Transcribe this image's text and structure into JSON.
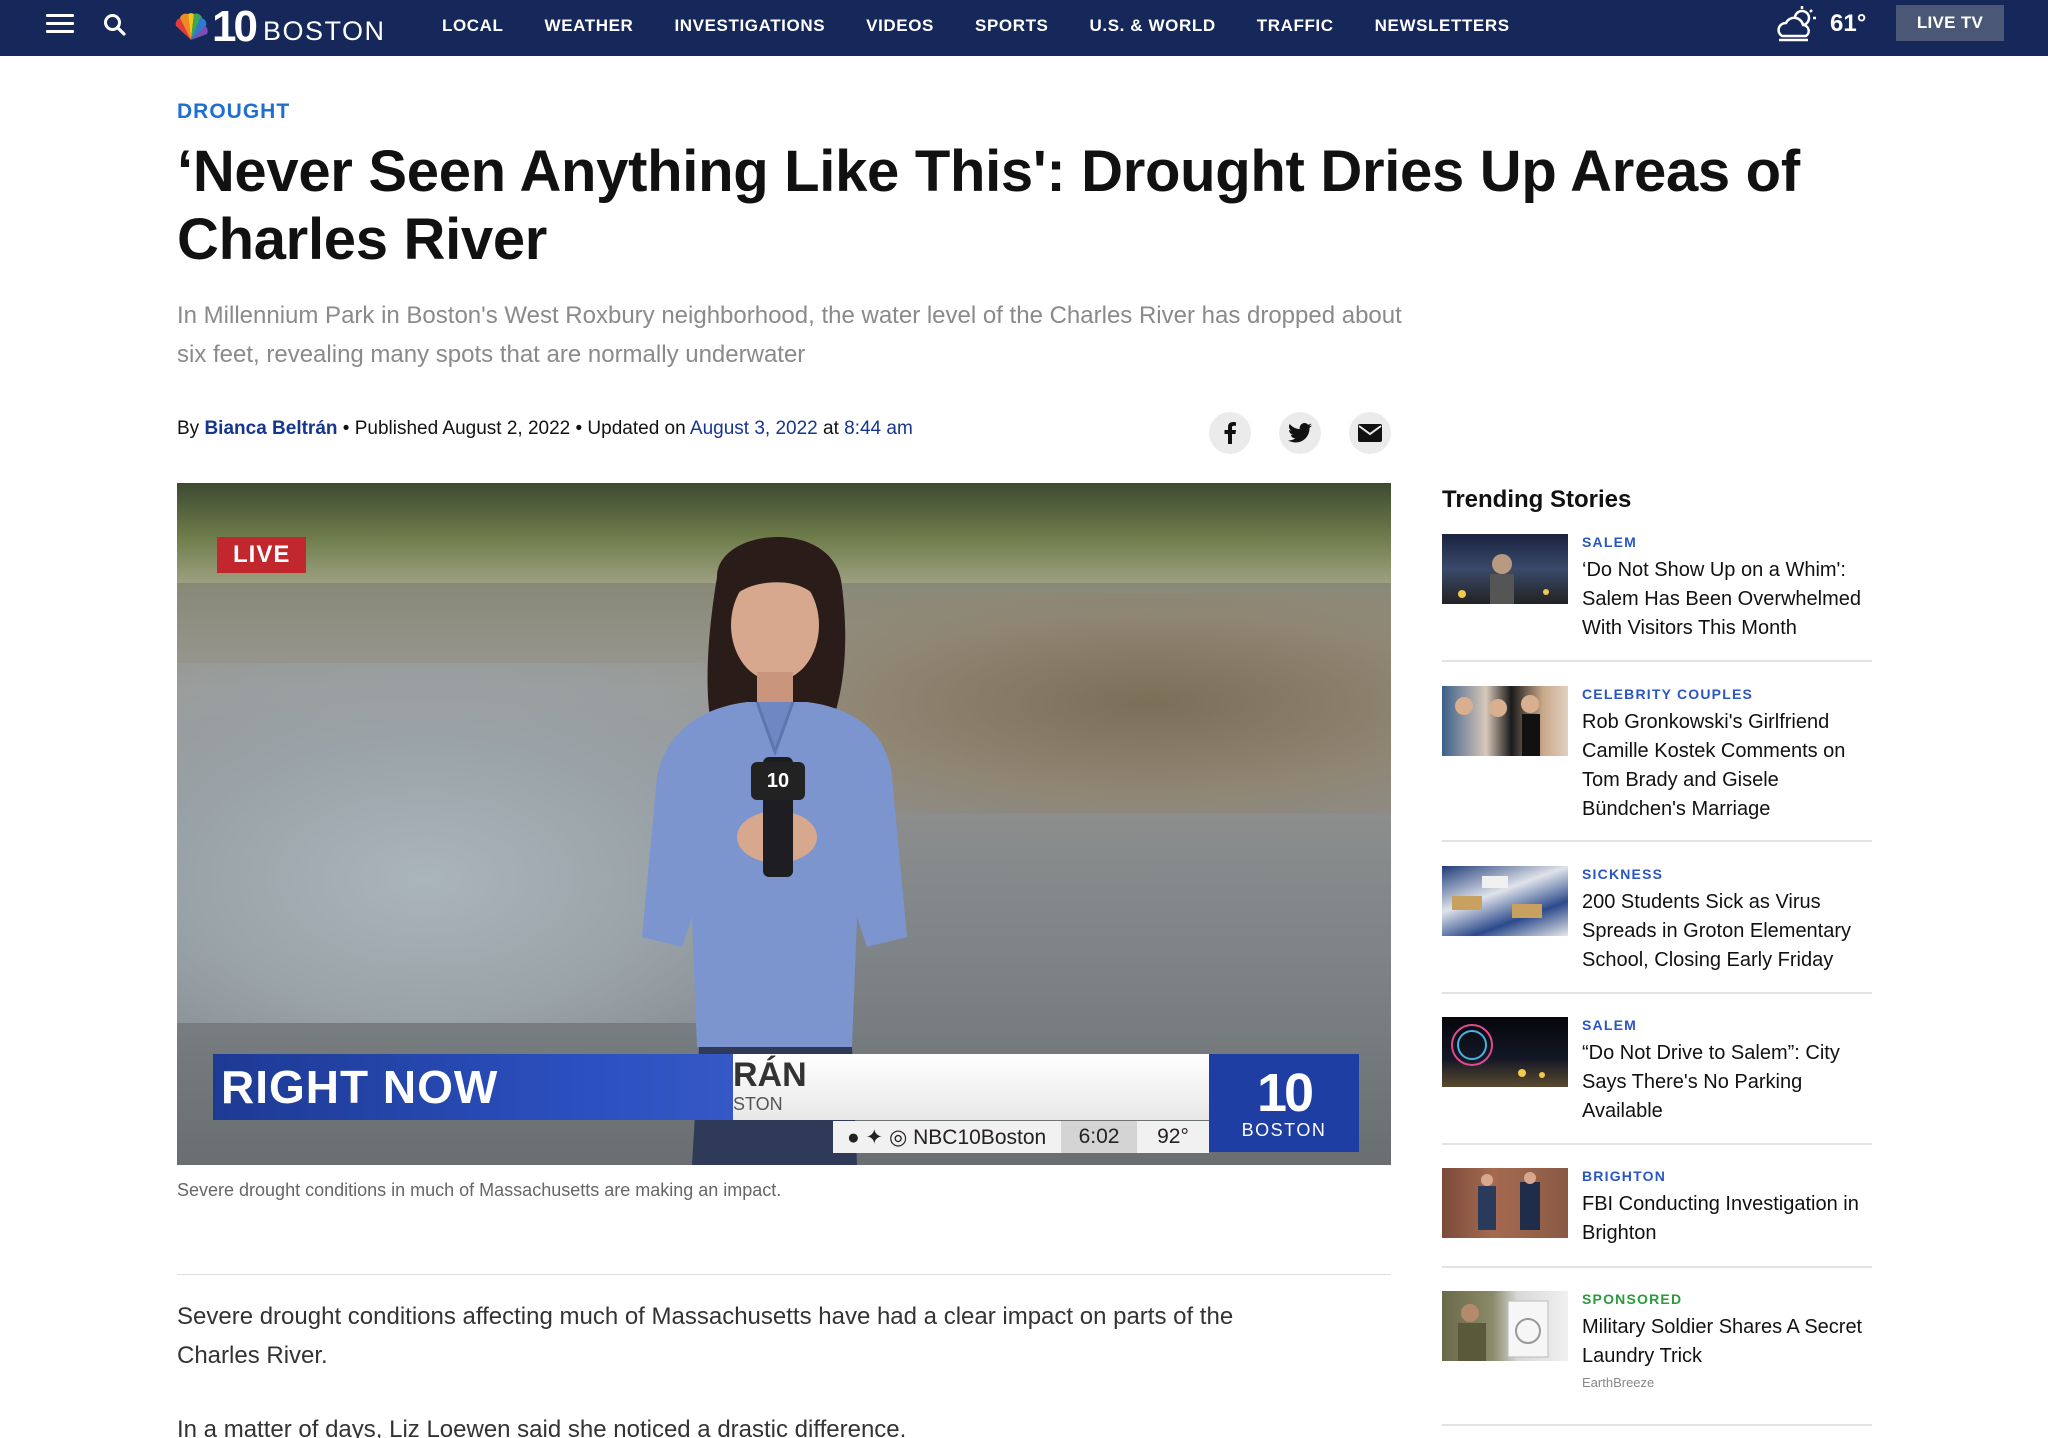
{
  "nav": {
    "brand_number": "10",
    "brand_city": "BOSTON",
    "links": [
      "LOCAL",
      "WEATHER",
      "INVESTIGATIONS",
      "VIDEOS",
      "SPORTS",
      "U.S. & WORLD",
      "TRAFFIC",
      "NEWSLETTERS"
    ],
    "temperature": "61°",
    "live_tv": "LIVE TV"
  },
  "article": {
    "kicker": "DROUGHT",
    "headline": "‘Never Seen Anything Like This': Drought Dries Up Areas of Charles River",
    "dek": "In Millennium Park in Boston's West Roxbury neighborhood, the water level of the Charles River has dropped about six feet, revealing many spots that are normally underwater",
    "byline_prefix": "By ",
    "author": "Bianca Beltrán",
    "published": " • Published August 2, 2022 • Updated on ",
    "updated_date": "August 3, 2022",
    "at": " at ",
    "updated_time": "8:44 am",
    "caption": "Severe drought conditions in much of Massachusetts are making an impact.",
    "paragraphs": [
      "Severe drought conditions affecting much of Massachusetts have had a clear impact on parts of the Charles River.",
      "In a matter of days, Liz Loewen said she noticed a drastic difference."
    ]
  },
  "video": {
    "live_badge": "LIVE",
    "lower_third": "RIGHT NOW",
    "name_fragment": "RÁN",
    "city_fragment": "STON",
    "handle": "NBC10Boston",
    "clock": "6:02",
    "temp": "92°",
    "logo_number": "10",
    "logo_city": "BOSTON"
  },
  "sidebar": {
    "title": "Trending Stories",
    "stories": [
      {
        "category": "SALEM",
        "title": "‘Do Not Show Up on a Whim': Salem Has Been Overwhelmed With Visitors This Month"
      },
      {
        "category": "CELEBRITY COUPLES",
        "title": "Rob Gronkowski's Girlfriend Camille Kostek Comments on Tom Brady and Gisele Bündchen's Marriage"
      },
      {
        "category": "SICKNESS",
        "title": "200 Students Sick as Virus Spreads in Groton Elementary School, Closing Early Friday"
      },
      {
        "category": "SALEM",
        "title": "“Do Not Drive to Salem”: City Says There's No Parking Available"
      },
      {
        "category": "BRIGHTON",
        "title": "FBI Conducting Investigation in Brighton"
      },
      {
        "category": "SPONSORED",
        "title": "Military Soldier Shares A Secret Laundry Trick",
        "source": "EarthBreeze"
      }
    ]
  },
  "colors": {
    "nav_bg": "#16285a",
    "kicker": "#1f6fd1",
    "link_blue": "#15358f",
    "live_red": "#c1272d",
    "sponsored_green": "#2a9a3a"
  }
}
